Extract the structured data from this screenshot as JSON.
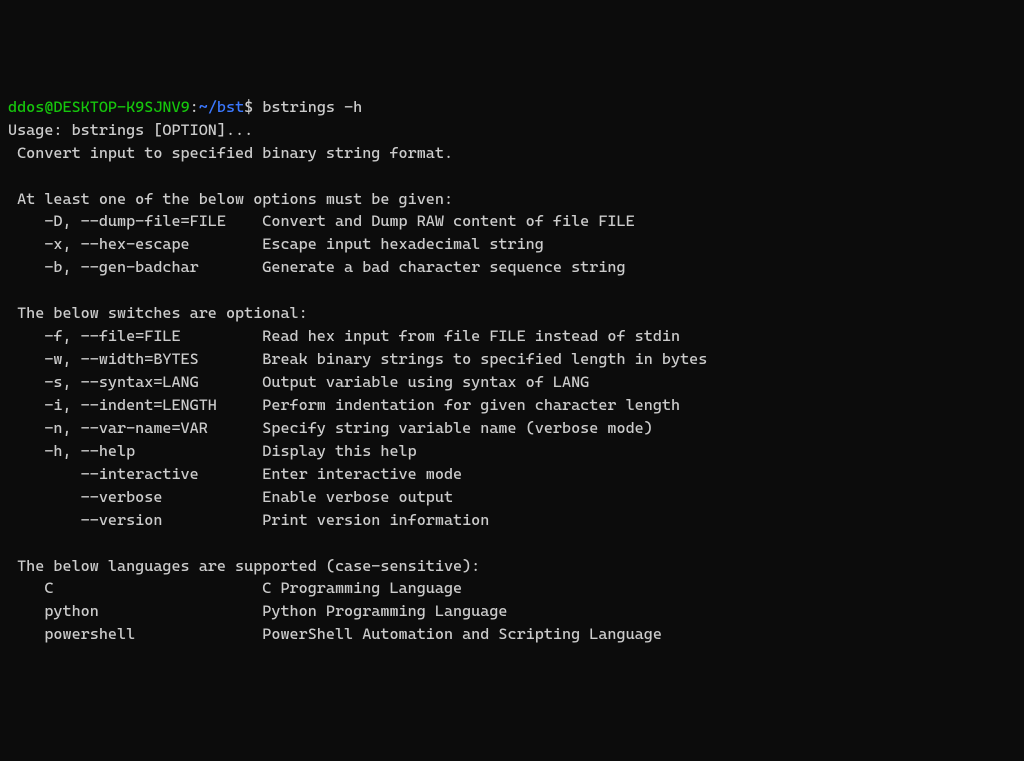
{
  "prompt": {
    "user": "ddos",
    "at": "@",
    "host": "DESKTOP-K9SJNV9",
    "colon": ":",
    "path": "~/bst",
    "dollar": "$",
    "command": " bstrings -h"
  },
  "usage": "Usage: bstrings [OPTION]...",
  "desc": " Convert input to specified binary string format.",
  "sec1_title": " At least one of the below options must be given:",
  "sec1_opts": [
    {
      "flag": "    -D, --dump-file=FILE    ",
      "desc": "Convert and Dump RAW content of file FILE"
    },
    {
      "flag": "    -x, --hex-escape        ",
      "desc": "Escape input hexadecimal string"
    },
    {
      "flag": "    -b, --gen-badchar       ",
      "desc": "Generate a bad character sequence string"
    }
  ],
  "sec2_title": " The below switches are optional:",
  "sec2_opts": [
    {
      "flag": "    -f, --file=FILE         ",
      "desc": "Read hex input from file FILE instead of stdin"
    },
    {
      "flag": "    -w, --width=BYTES       ",
      "desc": "Break binary strings to specified length in bytes"
    },
    {
      "flag": "    -s, --syntax=LANG       ",
      "desc": "Output variable using syntax of LANG"
    },
    {
      "flag": "    -i, --indent=LENGTH     ",
      "desc": "Perform indentation for given character length"
    },
    {
      "flag": "    -n, --var-name=VAR      ",
      "desc": "Specify string variable name (verbose mode)"
    },
    {
      "flag": "    -h, --help              ",
      "desc": "Display this help"
    },
    {
      "flag": "        --interactive       ",
      "desc": "Enter interactive mode"
    },
    {
      "flag": "        --verbose           ",
      "desc": "Enable verbose output"
    },
    {
      "flag": "        --version           ",
      "desc": "Print version information"
    }
  ],
  "sec3_title": " The below languages are supported (case-sensitive):",
  "sec3_langs": [
    {
      "name": "    C                       ",
      "desc": "C Programming Language"
    },
    {
      "name": "    python                  ",
      "desc": "Python Programming Language"
    },
    {
      "name": "    powershell              ",
      "desc": "PowerShell Automation and Scripting Language"
    }
  ]
}
